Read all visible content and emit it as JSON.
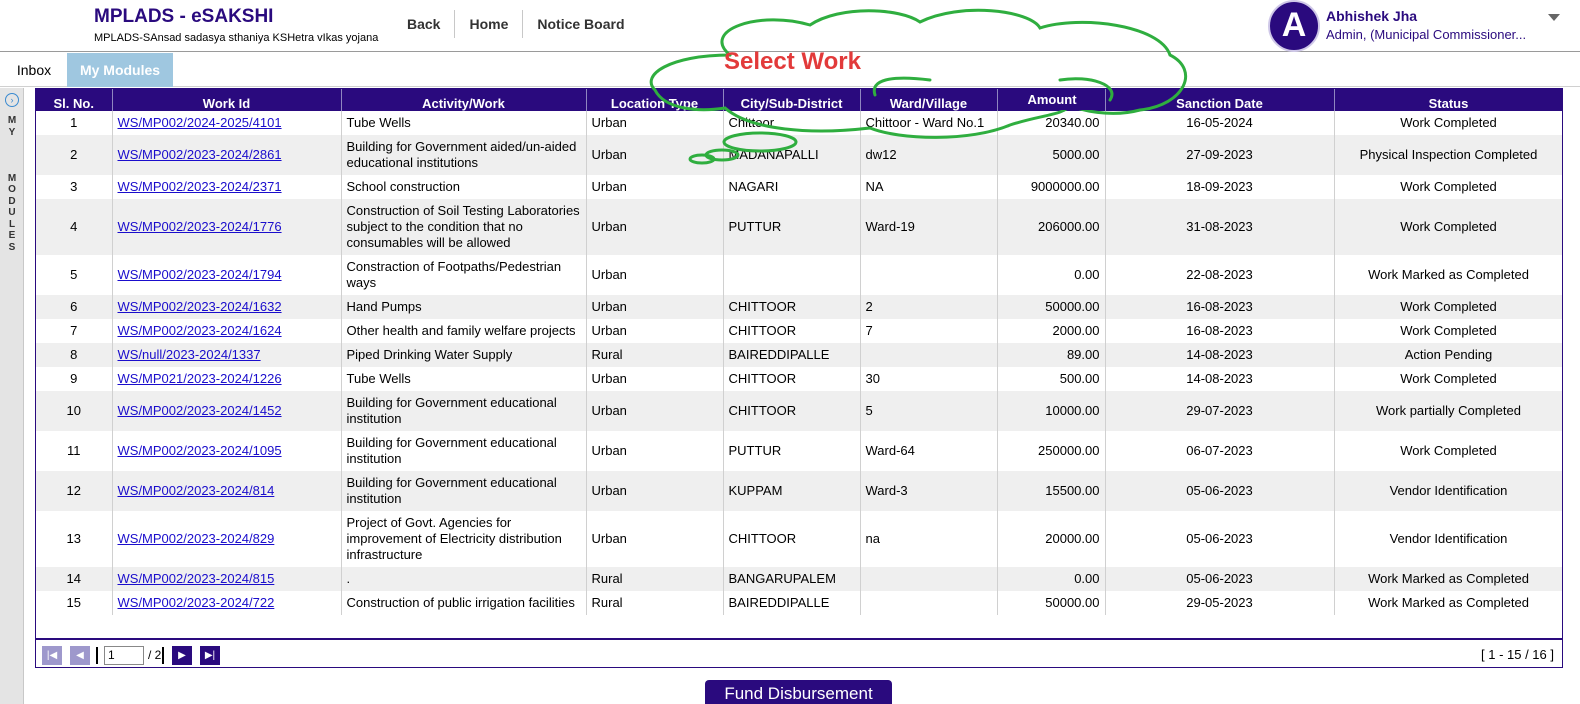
{
  "header": {
    "title": "MPLADS - eSAKSHI",
    "subtitle": "MPLADS-SAnsad sadasya sthaniya KSHetra vIkas yojana",
    "nav": [
      "Back",
      "Home",
      "Notice Board"
    ],
    "user": {
      "initial": "A",
      "name": "Abhishek Jha",
      "role": "Admin, (Municipal Commissioner..."
    }
  },
  "tabs": [
    "Inbox",
    "My Modules"
  ],
  "left_panel": {
    "label": "MY\n\nMODULES"
  },
  "annotation": {
    "text": "Select Work",
    "color": "#e23a3a",
    "cloud_color": "#2fae3f"
  },
  "grid": {
    "columns": [
      "Sl. No.",
      "Work Id",
      "Activity/Work",
      "Location Type",
      "City/Sub-District",
      "Ward/Village",
      "Amount",
      "Sanction Date",
      "Status"
    ],
    "rows": [
      {
        "sl": "1",
        "id": "WS/MP002/2024-2025/4101",
        "activity": "Tube Wells",
        "loc": "Urban",
        "city": "Chittoor",
        "ward": "Chittoor - Ward No.1",
        "amount": "20340.00",
        "date": "16-05-2024",
        "status": "Work Completed"
      },
      {
        "sl": "2",
        "id": "WS/MP002/2023-2024/2861",
        "activity": "Building for Government aided/un-aided educational institutions",
        "loc": "Urban",
        "city": "MADANAPALLI",
        "ward": "dw12",
        "amount": "5000.00",
        "date": "27-09-2023",
        "status": "Physical Inspection Completed"
      },
      {
        "sl": "3",
        "id": "WS/MP002/2023-2024/2371",
        "activity": "School construction",
        "loc": "Urban",
        "city": "NAGARI",
        "ward": "NA",
        "amount": "9000000.00",
        "date": "18-09-2023",
        "status": "Work Completed"
      },
      {
        "sl": "4",
        "id": "WS/MP002/2023-2024/1776",
        "activity": "Construction of Soil Testing Laboratories subject to the condition that no consumables will be allowed",
        "loc": "Urban",
        "city": "PUTTUR",
        "ward": "Ward-19",
        "amount": "206000.00",
        "date": "31-08-2023",
        "status": "Work Completed"
      },
      {
        "sl": "5",
        "id": "WS/MP002/2023-2024/1794",
        "activity": "Constraction of Footpaths/Pedestrian ways",
        "loc": "Urban",
        "city": "",
        "ward": "",
        "amount": "0.00",
        "date": "22-08-2023",
        "status": "Work Marked as Completed"
      },
      {
        "sl": "6",
        "id": "WS/MP002/2023-2024/1632",
        "activity": "Hand Pumps",
        "loc": "Urban",
        "city": "CHITTOOR",
        "ward": "2",
        "amount": "50000.00",
        "date": "16-08-2023",
        "status": "Work Completed"
      },
      {
        "sl": "7",
        "id": "WS/MP002/2023-2024/1624",
        "activity": "Other health and family welfare projects",
        "loc": "Urban",
        "city": "CHITTOOR",
        "ward": "7",
        "amount": "2000.00",
        "date": "16-08-2023",
        "status": "Work Completed"
      },
      {
        "sl": "8",
        "id": "WS/null/2023-2024/1337",
        "activity": "Piped Drinking Water Supply",
        "loc": "Rural",
        "city": "BAIREDDIPALLE",
        "ward": "",
        "amount": "89.00",
        "date": "14-08-2023",
        "status": "Action Pending"
      },
      {
        "sl": "9",
        "id": "WS/MP021/2023-2024/1226",
        "activity": "Tube Wells",
        "loc": "Urban",
        "city": "CHITTOOR",
        "ward": "30",
        "amount": "500.00",
        "date": "14-08-2023",
        "status": "Work Completed"
      },
      {
        "sl": "10",
        "id": "WS/MP002/2023-2024/1452",
        "activity": "Building for Government educational institution",
        "loc": "Urban",
        "city": "CHITTOOR",
        "ward": "5",
        "amount": "10000.00",
        "date": "29-07-2023",
        "status": "Work partially Completed"
      },
      {
        "sl": "11",
        "id": "WS/MP002/2023-2024/1095",
        "activity": "Building for Government educational institution",
        "loc": "Urban",
        "city": "PUTTUR",
        "ward": "Ward-64",
        "amount": "250000.00",
        "date": "06-07-2023",
        "status": "Work Completed"
      },
      {
        "sl": "12",
        "id": "WS/MP002/2023-2024/814",
        "activity": "Building for Government educational institution",
        "loc": "Urban",
        "city": "KUPPAM",
        "ward": "Ward-3",
        "amount": "15500.00",
        "date": "05-06-2023",
        "status": "Vendor Identification"
      },
      {
        "sl": "13",
        "id": "WS/MP002/2023-2024/829",
        "activity": "Project of Govt. Agencies for improvement of Electricity distribution infrastructure",
        "loc": "Urban",
        "city": "CHITTOOR",
        "ward": "na",
        "amount": "20000.00",
        "date": "05-06-2023",
        "status": "Vendor Identification"
      },
      {
        "sl": "14",
        "id": "WS/MP002/2023-2024/815",
        "activity": ".",
        "loc": "Rural",
        "city": "BANGARUPALEM",
        "ward": "",
        "amount": "0.00",
        "date": "05-06-2023",
        "status": "Work Marked as Completed"
      },
      {
        "sl": "15",
        "id": "WS/MP002/2023-2024/722",
        "activity": "Construction of public irrigation facilities",
        "loc": "Rural",
        "city": "BAIREDDIPALLE",
        "ward": "",
        "amount": "50000.00",
        "date": "29-05-2023",
        "status": "Work Marked as Completed"
      }
    ]
  },
  "pager": {
    "page": "1",
    "total_pages": "/ 2",
    "info": "[ 1 - 15 / 16 ]"
  },
  "fund_button": "Fund Disbursement",
  "colors": {
    "brand": "#2a0a7e",
    "tab_active": "#9fc7e0",
    "link": "#1a0dcc"
  }
}
